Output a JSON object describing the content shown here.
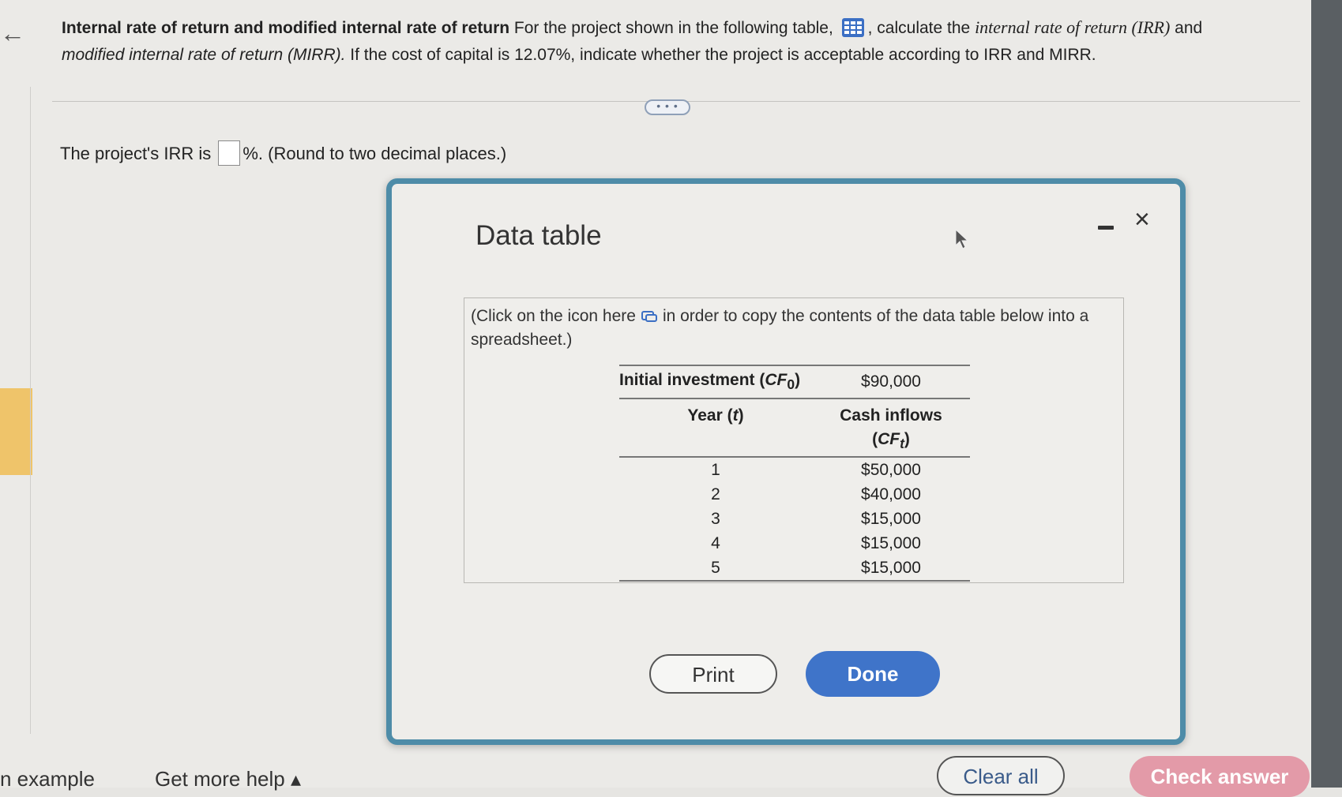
{
  "question": {
    "title": "Internal rate of return and modified internal rate of return",
    "text_before_icon": " For the project shown in the following table, ",
    "text_after_icon": ", calculate the ",
    "irr_term": "internal rate of return (IRR)",
    "and": " and",
    "mirr_term": "modified internal rate of return (MIRR).",
    "rest": " If the cost of capital is 12.07%, indicate whether the project is acceptable according to IRR and MIRR."
  },
  "more_label": "• • •",
  "prompt": {
    "before": "The project's IRR is ",
    "after": "%. (Round to two decimal places.)"
  },
  "modal": {
    "title": "Data table",
    "close_label": "×",
    "copy_note_before": "(Click on the icon here",
    "copy_note_after": "in order to copy the contents of the data table below into a spreadsheet.)",
    "table": {
      "init_label": "Initial investment (",
      "init_sym": "CF",
      "init_sub": "0",
      "init_close": ")",
      "init_value": "$90,000",
      "year_label": "Year (",
      "year_sym": "t",
      "year_close": ")",
      "cash_label": "Cash inflows",
      "cash_sym_open": "(",
      "cash_sym": "CF",
      "cash_sub": "t",
      "cash_sym_close": ")",
      "rows": [
        {
          "year": "1",
          "cash": "$50,000"
        },
        {
          "year": "2",
          "cash": "$40,000"
        },
        {
          "year": "3",
          "cash": "$15,000"
        },
        {
          "year": "4",
          "cash": "$15,000"
        },
        {
          "year": "5",
          "cash": "$15,000"
        }
      ]
    },
    "print_label": "Print",
    "done_label": "Done"
  },
  "footer": {
    "example_label": "n example",
    "help_label": "Get more help ▴",
    "clear_label": "Clear all",
    "check_label": "Check answer"
  },
  "colors": {
    "modal_border": "#4e8ca8",
    "done_button": "#3f74c9",
    "check_button": "#e39aa8",
    "accent_strip": "#efc46a"
  }
}
